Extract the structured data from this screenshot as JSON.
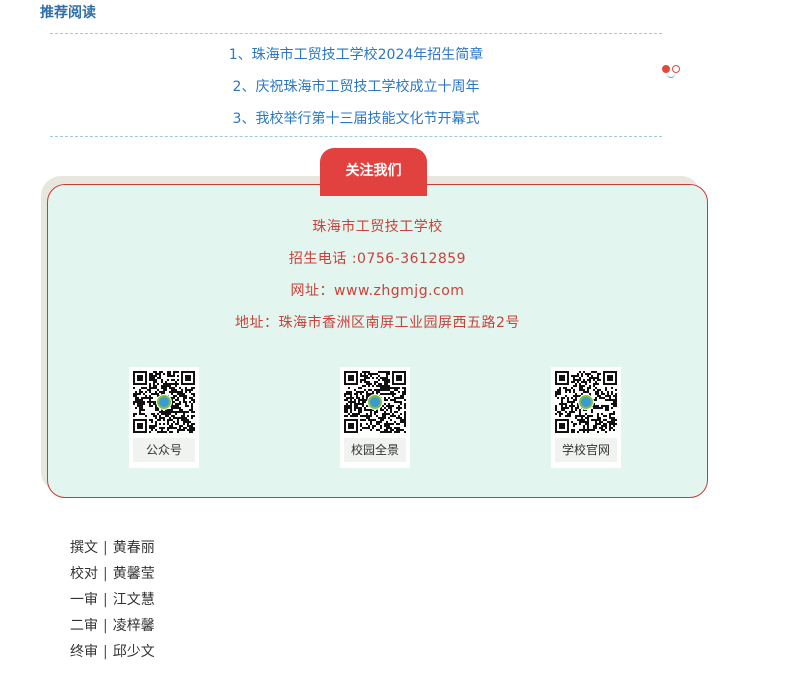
{
  "section_title": "推荐阅读",
  "recommended": [
    "1、珠海市工贸技工学校2024年招生简章",
    "2、庆祝珠海市工贸技工学校成立十周年",
    "3、我校举行第十三届技能文化节开幕式"
  ],
  "follow_tab": "关注我们",
  "school": {
    "name": "珠海市工贸技工学校",
    "phone": "招生电话 :0756-3612859",
    "website": "网址：www.zhgmjg.com",
    "address": "地址：珠海市香洲区南屏工业园屏西五路2号"
  },
  "qr_codes": [
    {
      "label": "公众号",
      "icon": "qr-code-icon"
    },
    {
      "label": "校园全景",
      "icon": "qr-code-icon"
    },
    {
      "label": "学校官网",
      "icon": "qr-code-icon"
    }
  ],
  "credits": [
    {
      "role": "撰文",
      "name": "黄春丽"
    },
    {
      "role": "校对",
      "name": "黄馨莹"
    },
    {
      "role": "一审",
      "name": "江文慧"
    },
    {
      "role": "二审",
      "name": "凌梓馨"
    },
    {
      "role": "终审",
      "name": "邱少文"
    }
  ],
  "colors": {
    "accent_red": "#e2423f",
    "link_blue": "#2c77c4",
    "card_bg": "#e2f5ee"
  }
}
